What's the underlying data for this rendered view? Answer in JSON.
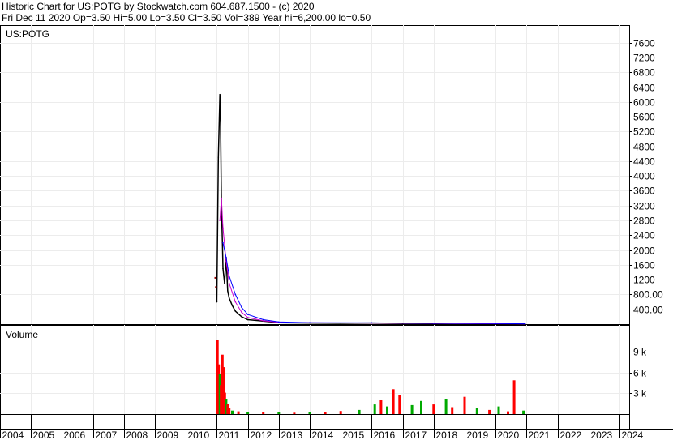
{
  "header": {
    "line1": "Historic Chart for US:POTG by Stockwatch.com 604.687.1500 - (c) 2020",
    "line2": "Fri Dec 11 2020  Op=3.50  Hi=5.00  Lo=3.50  Cl=3.50  Vol=389  Year hi=6,200.00  lo=0.50"
  },
  "chart_data": [
    {
      "type": "line",
      "panel_label": "US:POTG",
      "y_ticks": [
        "7600",
        "7200",
        "6800",
        "6400",
        "6000",
        "5600",
        "5200",
        "4800",
        "4400",
        "4000",
        "3600",
        "3200",
        "2800",
        "2400",
        "2000",
        "1600",
        "1200",
        "800.00",
        "400.00"
      ],
      "ylim": [
        0,
        7900
      ],
      "x_ticks": [
        "2004",
        "2005",
        "2006",
        "2007",
        "2008",
        "2009",
        "2010",
        "2011",
        "2012",
        "2013",
        "2014",
        "2015",
        "2016",
        "2017",
        "2018",
        "2019",
        "2020",
        "2021",
        "2022",
        "2023",
        "2024"
      ],
      "series": [
        {
          "color": "#000000",
          "x": [
            2011.0,
            2011.05,
            2011.1,
            2011.12,
            2011.15,
            2011.18,
            2011.2,
            2011.25,
            2011.3,
            2011.35,
            2011.4,
            2011.5,
            2011.6,
            2011.8,
            2012.0,
            2012.5,
            2013.0,
            2014.0,
            2015.0,
            2016.0,
            2017.0,
            2018.0,
            2019.0,
            2020.0,
            2020.95
          ],
          "y": [
            600,
            4500,
            6200,
            5500,
            3200,
            2200,
            1500,
            1100,
            1800,
            900,
            700,
            500,
            350,
            200,
            120,
            80,
            40,
            30,
            25,
            30,
            20,
            15,
            25,
            10,
            4
          ]
        },
        {
          "color": "#cc00cc",
          "x": [
            2011.1,
            2011.15,
            2011.2,
            2011.3,
            2011.4,
            2011.6,
            2011.8,
            2012.0,
            2012.5,
            2013.0,
            2014.0,
            2016.0,
            2018.0,
            2020.0,
            2020.95
          ],
          "y": [
            2800,
            3400,
            2600,
            1700,
            1100,
            600,
            320,
            180,
            90,
            50,
            35,
            30,
            20,
            12,
            6
          ]
        },
        {
          "color": "#0000ff",
          "x": [
            2011.2,
            2011.3,
            2011.4,
            2011.6,
            2011.8,
            2012.0,
            2012.5,
            2013.0,
            2014.0,
            2016.0,
            2018.0,
            2020.0,
            2020.95
          ],
          "y": [
            2200,
            1800,
            1300,
            800,
            450,
            260,
            120,
            60,
            40,
            35,
            25,
            15,
            8
          ]
        }
      ],
      "outliers": [
        {
          "x": 2010.95,
          "y": 1250
        },
        {
          "x": 2010.97,
          "y": 1000
        }
      ]
    },
    {
      "type": "bar",
      "panel_label": "Volume",
      "y_ticks": [
        "9 k",
        "6 k",
        "3 k"
      ],
      "ylim": [
        0,
        10800
      ],
      "x": [
        2011.02,
        2011.06,
        2011.1,
        2011.14,
        2011.18,
        2011.22,
        2011.26,
        2011.3,
        2011.35,
        2011.4,
        2011.5,
        2011.7,
        2012.0,
        2012.5,
        2013.0,
        2013.5,
        2014.0,
        2014.5,
        2015.0,
        2015.6,
        2016.1,
        2016.3,
        2016.5,
        2016.7,
        2016.9,
        2017.3,
        2017.6,
        2018.0,
        2018.4,
        2018.6,
        2019.0,
        2019.4,
        2019.8,
        2020.1,
        2020.4,
        2020.6,
        2020.9
      ],
      "values": [
        10800,
        7200,
        5800,
        4200,
        8600,
        6800,
        3100,
        2200,
        1500,
        900,
        500,
        400,
        350,
        300,
        250,
        200,
        250,
        300,
        450,
        600,
        1400,
        2000,
        1100,
        3600,
        2800,
        1300,
        1900,
        1400,
        2200,
        1000,
        2500,
        900,
        600,
        1100,
        400,
        4900,
        500
      ],
      "colors": [
        "#ff0000",
        "#ff0000",
        "#00aa00",
        "#ff0000",
        "#ff0000",
        "#ff0000",
        "#ff0000",
        "#00aa00",
        "#ff0000",
        "#ff0000",
        "#00aa00",
        "#ff0000",
        "#00aa00",
        "#ff0000",
        "#00aa00",
        "#ff0000",
        "#00aa00",
        "#ff0000",
        "#ff0000",
        "#00aa00",
        "#00aa00",
        "#ff0000",
        "#00aa00",
        "#ff0000",
        "#ff0000",
        "#00aa00",
        "#00aa00",
        "#ff0000",
        "#00aa00",
        "#ff0000",
        "#ff0000",
        "#00aa00",
        "#ff0000",
        "#00aa00",
        "#ff0000",
        "#ff0000",
        "#00aa00"
      ]
    }
  ]
}
